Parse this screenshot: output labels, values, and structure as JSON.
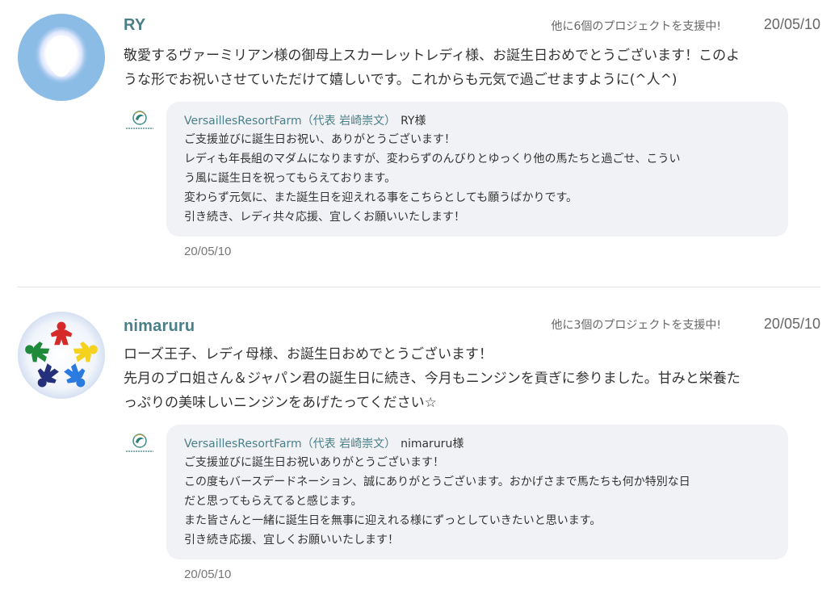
{
  "comments": [
    {
      "username": "RY",
      "support_note": "他に6個のプロジェクトを支援中!",
      "date": "20/05/10",
      "body_lines": [
        "敬愛するヴァーミリアン様の御母上スカーレットレディ様、お誕生日おめでとうございます！このよ",
        "うな形でお祝いさせていただけて嬉しいです。これからも元気で過ごせますように(^人^)"
      ],
      "reply": {
        "author": "VersaillesResortFarm（代表 岩崎崇文）",
        "to": "RY様",
        "lines": [
          "ご支援並びに誕生日お祝い、ありがとうございます！",
          "レディも年長組のマダムになりますが、変わらずのんびりとゆっくり他の馬たちと過ごせ、こうい",
          "う風に誕生日を祝ってもらえております。",
          "変わらず元気に、また誕生日を迎えれる事をこちらとしても願うばかりです。",
          "引き続き、レディ共々応援、宜しくお願いいたします！"
        ],
        "date": "20/05/10"
      }
    },
    {
      "username": "nimaruru",
      "support_note": "他に3個のプロジェクトを支援中!",
      "date": "20/05/10",
      "body_lines": [
        "ローズ王子、レディ母様、お誕生日おめでとうございます！",
        "先月のブロ姐さん＆ジャパン君の誕生日に続き、今月もニンジンを貢ぎに参りました。甘みと栄養た",
        "っぷりの美味しいニンジンをあげたってください☆"
      ],
      "reply": {
        "author": "VersaillesResortFarm（代表 岩崎崇文）",
        "to": "nimaruru様",
        "lines": [
          "ご支援並びに誕生日お祝いありがとうございます！",
          "この度もバースデードネーション、誠にありがとうございます。おかげさまで馬たちも何か特別な日",
          "だと思ってもらえてると感じます。",
          "また皆さんと一緒に誕生日を無事に迎えれる様にずっとしていきたいと思います。",
          "引き続き応援、宜しくお願いいたします！"
        ],
        "date": "20/05/10"
      }
    }
  ],
  "colors": {
    "username": "#4a7f88",
    "reply_bg": "#f1f2f5",
    "avatar_ry_bg": "#8bbce6"
  },
  "icons": {
    "avatar_ry": "blob-avatar-icon",
    "avatar_nimaruru": "meeple-circle-icon",
    "farm_logo": "versailles-resort-farm-logo"
  }
}
